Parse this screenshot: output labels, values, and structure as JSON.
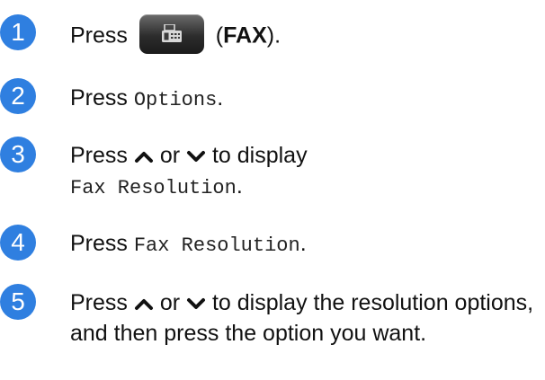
{
  "steps": [
    {
      "number": "1",
      "press": "Press",
      "paren_open": " (",
      "button_name": "FAX",
      "paren_close": ")."
    },
    {
      "number": "2",
      "press": "Press",
      "option": "Options",
      "end": "."
    },
    {
      "number": "3",
      "press": "Press",
      "or": "or",
      "to_display": "to display",
      "option": "Fax Resolution",
      "end": "."
    },
    {
      "number": "4",
      "press": "Press",
      "option": "Fax Resolution",
      "end": "."
    },
    {
      "number": "5",
      "press": "Press",
      "or": "or",
      "rest": "to display the resolution options, and then press the option you want."
    }
  ],
  "colors": {
    "step_badge": "#2f7fe0",
    "fax_button": "#2c2c2c"
  },
  "icons": {
    "up_arrow": "chevron-up-icon",
    "down_arrow": "chevron-down-icon",
    "fax": "fax-machine-icon"
  }
}
